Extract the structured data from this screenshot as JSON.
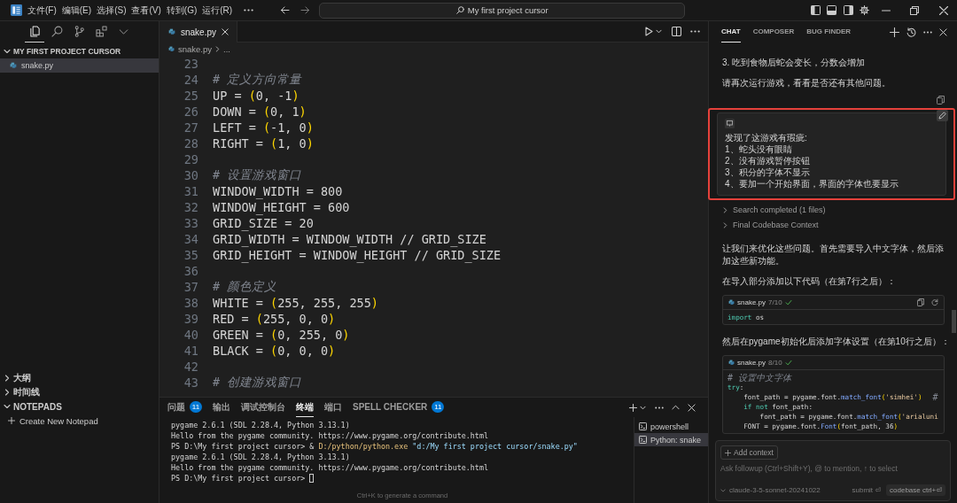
{
  "titlebar": {
    "menu": [
      "文件(F)",
      "编辑(E)",
      "选择(S)",
      "查看(V)",
      "转到(G)",
      "运行(R)"
    ],
    "title": "My first project cursor"
  },
  "activity_bar": [
    {
      "kind": "files",
      "selected": true
    },
    {
      "kind": "search",
      "selected": false
    },
    {
      "kind": "source_control",
      "selected": false
    },
    {
      "kind": "extensions",
      "selected": false
    },
    {
      "kind": "more",
      "selected": false
    }
  ],
  "sidebar": {
    "folder": {
      "label": "MY FIRST PROJECT CURSOR",
      "expanded": true,
      "files": [
        {
          "name": "snake.py",
          "selected": true
        }
      ]
    },
    "sections": [
      {
        "label": "大纲",
        "expanded": false
      },
      {
        "label": "时间线",
        "expanded": false
      },
      {
        "label": "NOTEPADS",
        "expanded": true,
        "items": [
          {
            "label": "Create New Notepad"
          }
        ]
      }
    ]
  },
  "editor": {
    "tabs": [
      {
        "label": "snake.py",
        "selected": true
      }
    ],
    "breadcrumb": [
      "snake.py",
      "..."
    ],
    "lines": [
      {
        "number": "23"
      },
      {
        "number": "24",
        "tokens": [
          {
            "text": "# 定义方向常量",
            "kind": "comment"
          }
        ]
      },
      {
        "number": "25",
        "tokens": [
          {
            "text": "UP = ",
            "kind": "plain"
          },
          {
            "text": "(",
            "kind": "bracket"
          },
          {
            "text": "0, -1",
            "kind": "plain"
          },
          {
            "text": ")",
            "kind": "bracket"
          }
        ]
      },
      {
        "number": "26",
        "tokens": [
          {
            "text": "DOWN = ",
            "kind": "plain"
          },
          {
            "text": "(",
            "kind": "bracket"
          },
          {
            "text": "0, 1",
            "kind": "plain"
          },
          {
            "text": ")",
            "kind": "bracket"
          }
        ]
      },
      {
        "number": "27",
        "tokens": [
          {
            "text": "LEFT = ",
            "kind": "plain"
          },
          {
            "text": "(",
            "kind": "bracket"
          },
          {
            "text": "-1, 0",
            "kind": "plain"
          },
          {
            "text": ")",
            "kind": "bracket"
          }
        ]
      },
      {
        "number": "28",
        "tokens": [
          {
            "text": "RIGHT = ",
            "kind": "plain"
          },
          {
            "text": "(",
            "kind": "bracket"
          },
          {
            "text": "1, 0",
            "kind": "plain"
          },
          {
            "text": ")",
            "kind": "bracket"
          }
        ]
      },
      {
        "number": "29"
      },
      {
        "number": "30",
        "tokens": [
          {
            "text": "# 设置游戏窗口",
            "kind": "comment"
          }
        ]
      },
      {
        "number": "31",
        "tokens": [
          {
            "text": "WINDOW_WIDTH = 800",
            "kind": "plain"
          }
        ]
      },
      {
        "number": "32",
        "tokens": [
          {
            "text": "WINDOW_HEIGHT = 600",
            "kind": "plain"
          }
        ]
      },
      {
        "number": "33",
        "tokens": [
          {
            "text": "GRID_SIZE = 20",
            "kind": "plain"
          }
        ]
      },
      {
        "number": "34",
        "tokens": [
          {
            "text": "GRID_WIDTH = WINDOW_WIDTH // GRID_SIZE",
            "kind": "plain"
          }
        ]
      },
      {
        "number": "35",
        "tokens": [
          {
            "text": "GRID_HEIGHT = WINDOW_HEIGHT // GRID_SIZE",
            "kind": "plain"
          }
        ]
      },
      {
        "number": "36"
      },
      {
        "number": "37",
        "tokens": [
          {
            "text": "# 颜色定义",
            "kind": "comment"
          }
        ]
      },
      {
        "number": "38",
        "tokens": [
          {
            "text": "WHITE = ",
            "kind": "plain"
          },
          {
            "text": "(",
            "kind": "bracket"
          },
          {
            "text": "255, 255, 255",
            "kind": "plain"
          },
          {
            "text": ")",
            "kind": "bracket"
          }
        ]
      },
      {
        "number": "39",
        "tokens": [
          {
            "text": "RED = ",
            "kind": "plain"
          },
          {
            "text": "(",
            "kind": "bracket"
          },
          {
            "text": "255, 0, 0",
            "kind": "plain"
          },
          {
            "text": ")",
            "kind": "bracket"
          }
        ]
      },
      {
        "number": "40",
        "tokens": [
          {
            "text": "GREEN = ",
            "kind": "plain"
          },
          {
            "text": "(",
            "kind": "bracket"
          },
          {
            "text": "0, 255, 0",
            "kind": "plain"
          },
          {
            "text": ")",
            "kind": "bracket"
          }
        ]
      },
      {
        "number": "41",
        "tokens": [
          {
            "text": "BLACK = ",
            "kind": "plain"
          },
          {
            "text": "(",
            "kind": "bracket"
          },
          {
            "text": "0, 0, 0",
            "kind": "plain"
          },
          {
            "text": ")",
            "kind": "bracket"
          }
        ]
      },
      {
        "number": "42"
      },
      {
        "number": "43",
        "tokens": [
          {
            "text": "# 创建游戏窗口",
            "kind": "comment"
          }
        ]
      }
    ]
  },
  "panel": {
    "tabs": [
      {
        "label": "问题",
        "badge": "11",
        "selected": false
      },
      {
        "label": "输出",
        "selected": false
      },
      {
        "label": "调试控制台",
        "selected": false
      },
      {
        "label": "终端",
        "selected": true
      },
      {
        "label": "端口",
        "selected": false
      },
      {
        "label": "SPELL CHECKER",
        "badge": "11",
        "selected": false
      }
    ],
    "terminal": {
      "lines": [
        [
          {
            "text": "pygame 2.6.1 (SDL 2.28.4, Python 3.13.1)",
            "kind": "plain"
          }
        ],
        [
          {
            "text": "Hello from the pygame community. https://www.pygame.org/contribute.html",
            "kind": "plain"
          }
        ],
        [
          {
            "text": "PS D:\\My first project cursor> & ",
            "kind": "plain"
          },
          {
            "text": "D:/python/python.exe",
            "kind": "path"
          },
          {
            "text": " \"d:/My first project cursor/snake.py\"",
            "kind": "quoted"
          }
        ],
        [
          {
            "text": "pygame 2.6.1 (SDL 2.28.4, Python 3.13.1)",
            "kind": "plain"
          }
        ],
        [
          {
            "text": "Hello from the pygame community. https://www.pygame.org/contribute.html",
            "kind": "plain"
          }
        ],
        [
          {
            "text": "PS D:\\My first project cursor> ",
            "kind": "plain"
          }
        ]
      ],
      "cursor": true,
      "hint": "Ctrl+K to generate a command"
    },
    "terminals": [
      {
        "label": "powershell",
        "selected": false
      },
      {
        "label": "Python: snake",
        "selected": true
      }
    ]
  },
  "chat": {
    "tabs": [
      {
        "label": "CHAT",
        "selected": true
      },
      {
        "label": "COMPOSER",
        "selected": false
      },
      {
        "label": "BUG FINDER",
        "selected": false
      }
    ],
    "messages": [
      {
        "kind": "text",
        "text": "3. 吃到食物后蛇会变长，分数会增加"
      },
      {
        "kind": "text",
        "text": "请再次运行游戏，看看是否还有其他问题。",
        "copyable": true
      },
      {
        "kind": "user",
        "highlighted": true,
        "lines": [
          "发现了这游戏有瑕疵:",
          "1、蛇头没有眼睛",
          "2、没有游戏暂停按钮",
          "3、积分的字体不显示",
          "4、要加一个开始界面，界面的字体也要显示"
        ]
      },
      {
        "kind": "step",
        "label": "Search completed (1 files)",
        "expanded": false
      },
      {
        "kind": "step",
        "label": "Final Codebase Context",
        "expanded": false
      },
      {
        "kind": "text",
        "text": "让我们来优化这些问题。首先需要导入中文字体，然后添加这些新功能。"
      },
      {
        "kind": "text",
        "text": "在导入部分添加以下代码（在第7行之后）："
      },
      {
        "kind": "code",
        "file": "snake.py",
        "progress": "7/10",
        "applied": true,
        "show_actions": true,
        "lines": [
          [
            {
              "text": "import",
              "kind": "keyword"
            },
            {
              "text": " os",
              "kind": "plain"
            }
          ]
        ]
      },
      {
        "kind": "text",
        "text": "然后在pygame初始化后添加字体设置（在第10行之后）："
      },
      {
        "kind": "code",
        "file": "snake.py",
        "progress": "8/10",
        "applied": true,
        "show_actions": false,
        "lines": [
          [
            {
              "text": "# 设置中文字体",
              "kind": "comment"
            }
          ],
          [
            {
              "text": "try",
              "kind": "keyword"
            },
            {
              "text": ":",
              "kind": "plain"
            }
          ],
          [
            {
              "text": "    font_path = pygame.font.",
              "kind": "plain"
            },
            {
              "text": "match_font",
              "kind": "func"
            },
            {
              "text": "(",
              "kind": "bracket"
            },
            {
              "text": "'simhei'",
              "kind": "string"
            },
            {
              "text": ")",
              "kind": "bracket"
            },
            {
              "text": "  #",
              "kind": "comment"
            }
          ],
          [
            {
              "text": "    if not",
              "kind": "keyword"
            },
            {
              "text": " font_path:",
              "kind": "plain"
            }
          ],
          [
            {
              "text": "        font_path = pygame.font.",
              "kind": "plain"
            },
            {
              "text": "match_font",
              "kind": "func"
            },
            {
              "text": "(",
              "kind": "bracket"
            },
            {
              "text": "'arialuni",
              "kind": "string"
            }
          ],
          [
            {
              "text": "    FONT = pygame.font.",
              "kind": "plain"
            },
            {
              "text": "Font",
              "kind": "func"
            },
            {
              "text": "(",
              "kind": "bracket"
            },
            {
              "text": "font_path, 36",
              "kind": "plain"
            },
            {
              "text": ")",
              "kind": "bracket"
            }
          ]
        ]
      }
    ],
    "input": {
      "context_button": "Add context",
      "placeholder": "Ask followup (Ctrl+Shift+Y), @ to mention, ↑ to select",
      "model": "claude-3-5-sonnet-20241022",
      "submit": "submit ⏎",
      "codebase": "codebase ctrl+⏎"
    }
  }
}
